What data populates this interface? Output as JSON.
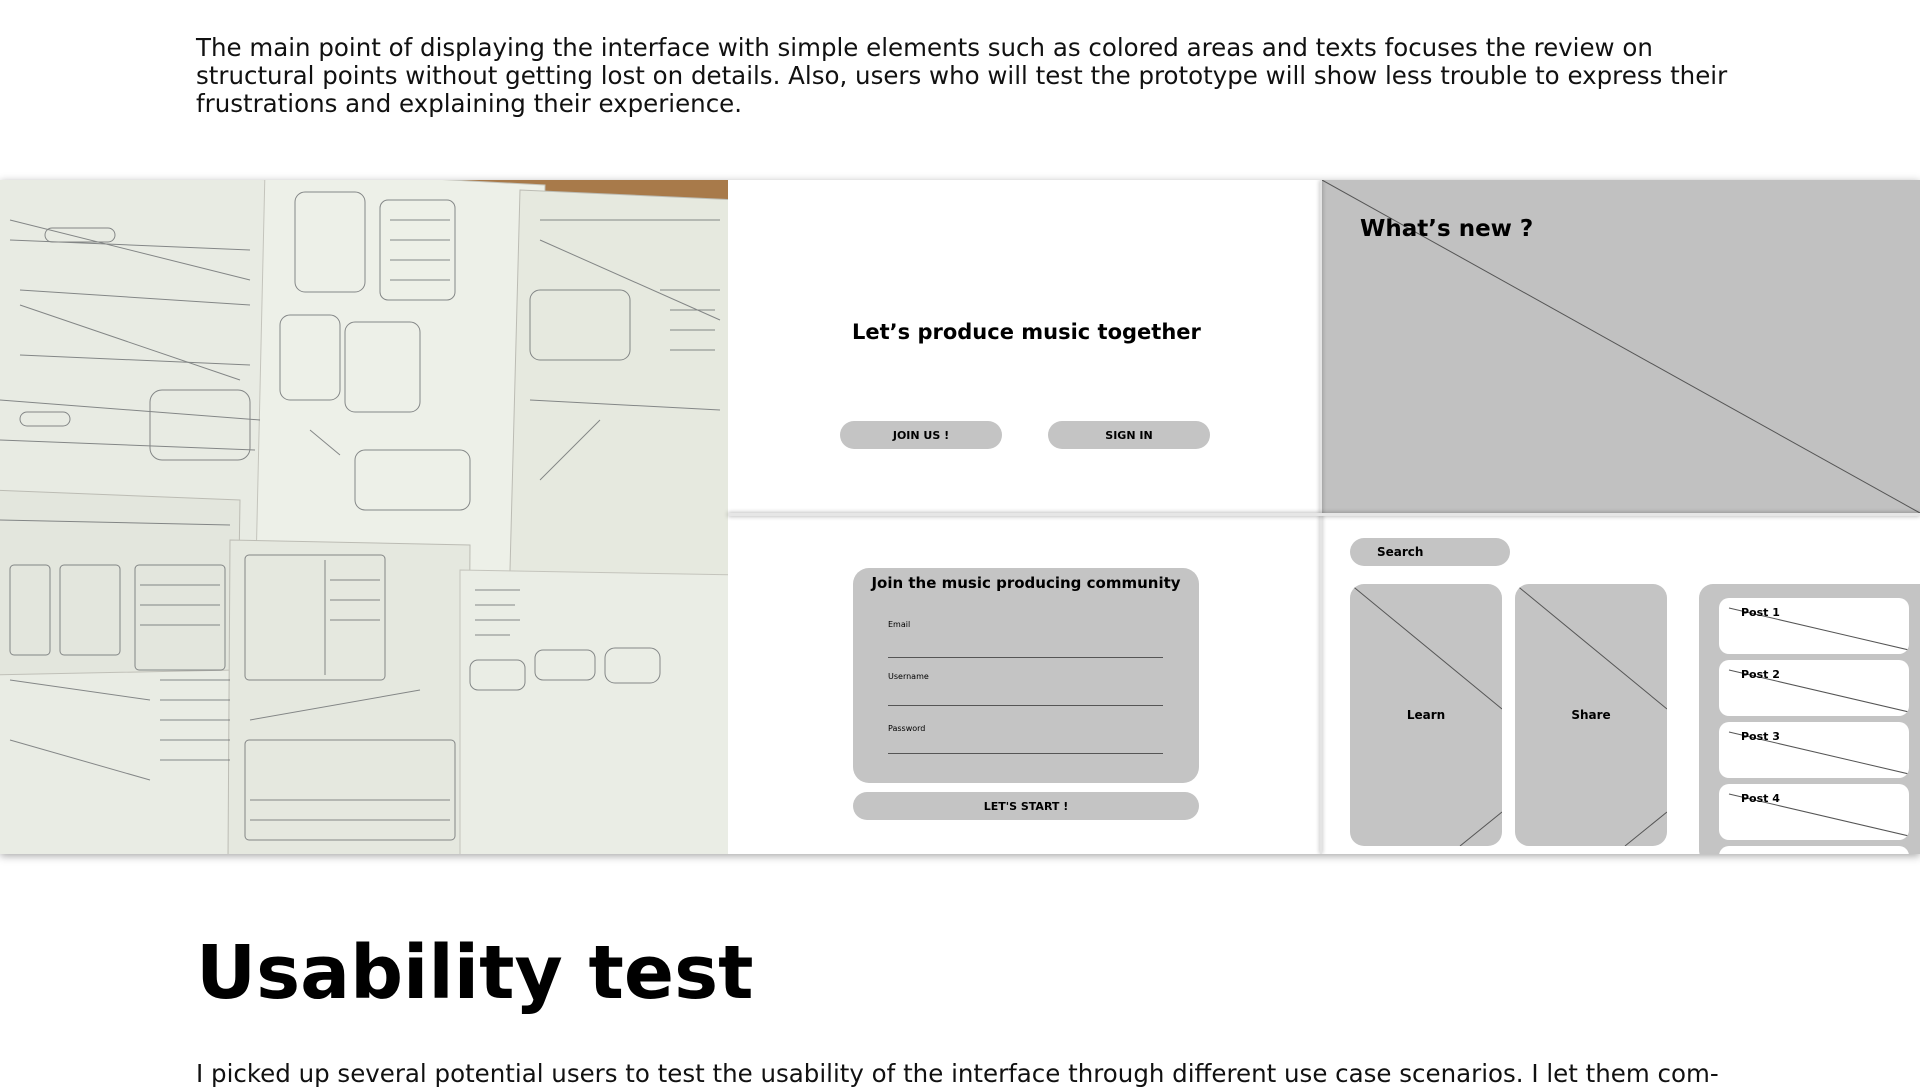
{
  "intro_paragraph": "The main point of displaying the interface with simple elements such as colored areas and texts focuses the review on structural points without getting lost on details. Also, users who will test the prototype will show less trouble to express their frustrations and explaining their experience.",
  "section_heading": "Usability test",
  "next_paragraph": "I picked up several potential users to test the usability of the interface through different use case scenarios. I let them com-",
  "wireframes": {
    "landing": {
      "title": "Let’s produce music together",
      "join_button": "JOIN US !",
      "signin_button": "SIGN IN"
    },
    "news": {
      "title": "What’s new ?"
    },
    "signup": {
      "title": "Join the music producing community",
      "fields": [
        "Email",
        "Username",
        "Password"
      ],
      "submit_button": "LET'S START !"
    },
    "dashboard": {
      "search_label": "Search",
      "cards": [
        "Learn",
        "Share"
      ],
      "posts": [
        "Post 1",
        "Post 2",
        "Post 3",
        "Post 4"
      ]
    }
  },
  "colors": {
    "wireframe_gray": "#c4c4c4",
    "news_gray": "#c1c1c1",
    "table_wood": "#a87a4a"
  }
}
